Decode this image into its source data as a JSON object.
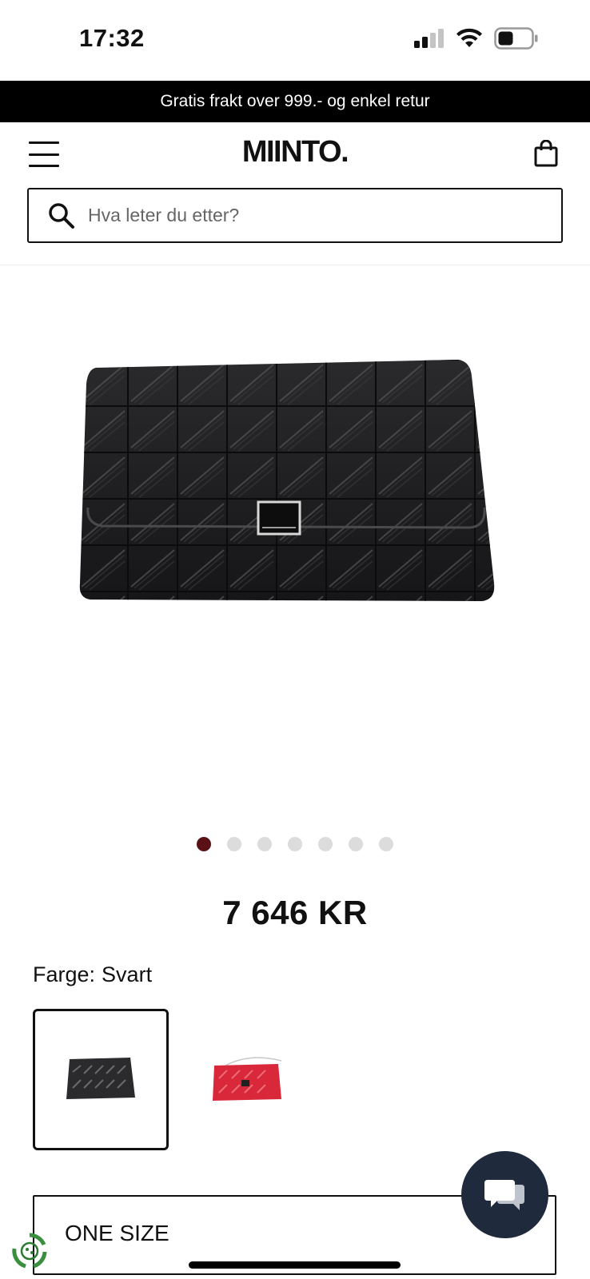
{
  "status_bar": {
    "time": "17:32",
    "icons": [
      "cellular-signal-icon",
      "wifi-icon",
      "battery-icon"
    ]
  },
  "promo_banner": {
    "text": "Gratis frakt over 999.- og enkel retur"
  },
  "header": {
    "logo": "MIINTO.",
    "menu_icon": "hamburger-menu-icon",
    "cart_icon": "shopping-bag-icon"
  },
  "search": {
    "placeholder": "Hva leter du etter?",
    "value": ""
  },
  "gallery": {
    "image": "black-quilted-leather-handbag",
    "dot_count": 7,
    "active_index": 0
  },
  "product": {
    "price": "7 646 KR",
    "color_label": "Farge:",
    "color_value": "Svart",
    "colors": [
      {
        "name": "Svart",
        "hex": "#1a1a1a",
        "selected": true
      },
      {
        "name": "Red",
        "hex": "#d8283a",
        "selected": false
      }
    ],
    "size": "ONE SIZE"
  },
  "widgets": {
    "chat_icon": "chat-bubbles-icon",
    "eco_icon": "eco-recycle-badge-icon"
  },
  "colors": {
    "promo_bg": "#000000",
    "active_dot": "#5a1115",
    "chat_bg": "#1f2a3c",
    "eco_green": "#3a8f3f"
  }
}
